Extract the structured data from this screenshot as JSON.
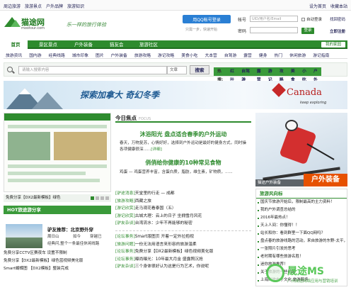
{
  "topbar": {
    "left": [
      "周边旅游",
      "旅游景点",
      "户外品牌",
      "旅游知识"
    ],
    "right": [
      "设为首页",
      "收藏本站"
    ]
  },
  "logo": {
    "name": "猫途网",
    "domain": "mootour.com"
  },
  "slogan": "乐一样的旅行体验",
  "qq": {
    "button": "用QQ帐号登录",
    "note": "只需一步，快速开始"
  },
  "login": {
    "user_label": "帐号",
    "user_placeholder": "UID/用户名/Email",
    "pwd_label": "密码",
    "auto_login": "自动登录",
    "find_pwd": "找回密码",
    "login_btn": "登录",
    "register": "立即注册"
  },
  "nav": {
    "items": [
      "首页",
      "景区景点",
      "户外装备",
      "猫友会",
      "旅游社区"
    ],
    "my_area": "我的家园"
  },
  "subnav": [
    "旅游资讯",
    "国内游",
    "经典线路",
    "城市印象",
    "图片",
    "户外装备",
    "旅游攻略",
    "游记攻略",
    "美食小吃",
    "大本营",
    "自驾游",
    "露营",
    "健身",
    "热门",
    "休闲旅游",
    "游记指南"
  ],
  "search": {
    "placeholder": "请输入搜索内容",
    "select": "文章",
    "button": "搜索",
    "hot_label": "热搜:",
    "hot": [
      "红叶",
      "自驾游",
      "露营",
      "游记",
      "攻略",
      "美食",
      "小吃",
      "户外"
    ]
  },
  "banner": {
    "text": "探索加拿大  奇幻冬季",
    "brand": "Canada",
    "tagline": "keep exploring"
  },
  "left": {
    "caption": "免费分享【DX2最新模板】绿色",
    "hot_title": "HOT旅途游分享",
    "feature": {
      "title": "驴友推荐：北京野外穿",
      "lines": [
        "周日山",
        "如今",
        "穿越已",
        "经典闪,整个一条最佳休闲线路"
      ]
    },
    "hot_list": [
      "免费分享CCTV区赛夜车 设置不限制",
      "免费分享【DX2最新模板】绿色蓝视频美化版",
      "Smart蝴蝶图 【DX2模板】整装完成"
    ]
  },
  "center": {
    "focus_title": "今日焦点",
    "focus_en": "FOCUS",
    "headline1": "沐浴阳光  盘点适合春季的户外运动",
    "desc1": "春天，万物复苏，心情好好，选择到户外运动是最好的健身方式，同时操各项健康很深......",
    "desc1_more": "[详细]",
    "headline2": "俏俏给你健康的10种常见食物",
    "desc2": "鸡蛋 — 鸡蛋营养丰富，含蛋白质，脂肪，维生素，矿物质，......",
    "groups": [
      [
        {
          "tag": "[驴途消息]",
          "text": "天堂里的行走 — 成都"
        },
        {
          "tag": "[旅游攻略]",
          "text": "西藏之旅"
        },
        {
          "tag": "[游记欣赏]",
          "text": "走马观花看泰国（五）"
        },
        {
          "tag": "[游记欣赏]",
          "text": "古城大理：云上的日子 坐拥雪月风花"
        },
        {
          "tag": "[驴友杂谈]",
          "text": "台湾流水：少年不再能够的秘密"
        }
      ],
      [
        {
          "tag": "[论坛事务]",
          "text": "Smart版图页 开着一定外拉抱视"
        },
        {
          "tag": "[旅游问题]",
          "text": "一份无法用语言来形容的旅游温柔"
        },
        {
          "tag": "[论坛事务]",
          "text": "免费分享【DX2最新模板】绿色视频美化版"
        },
        {
          "tag": "[论坛事务]",
          "text": "曝尚曝光：10年最大月金 盛露照沉抢"
        },
        {
          "tag": "[驴友杂谈]",
          "text": "三个身体很好认为这是行为艺术，你说呢"
        }
      ]
    ]
  },
  "right": {
    "ski_caption": "猫途户外装备",
    "ski_tag": "户外装备",
    "law_title": "旅游风向标",
    "law": [
      "国庆节旅游开始后，限制最高的主力资料！",
      "我的户外调查总结的",
      "2016年最热点！",
      "天上人间：你懂得！！",
      "站长和你：看到群里一下面QQ网吗？",
      "盘点春的旅游线路的活动，来自旅游的东野-太平，",
      "一张照片引发的思考",
      "老时期有哪些旅游名胜！",
      "迷你旅游推荐！",
      "关于旅游的一些问题",
      "上海尚旅电子文化 旅游服务"
    ]
  },
  "watermark": {
    "brand": "晟途MS",
    "sub": "广州晟途网络应用与营销培训"
  },
  "colors": {
    "brand_green": "#2e8b2e",
    "accent_orange": "#e65100",
    "link": "#222255"
  }
}
